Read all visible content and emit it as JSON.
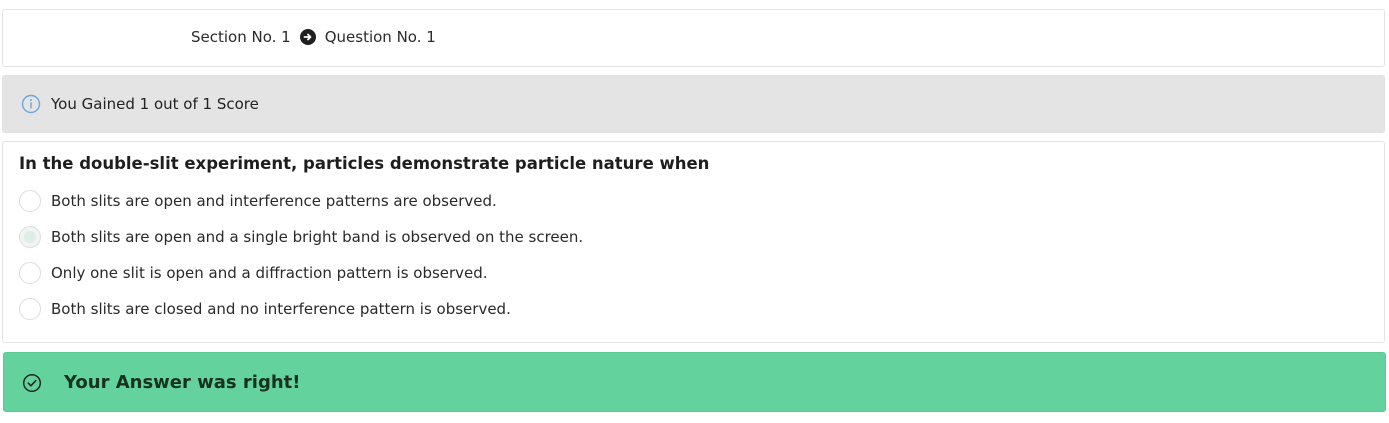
{
  "breadcrumb": {
    "section": "Section No. 1",
    "question": "Question No. 1",
    "separator_icon": "arrow-right-circle-icon"
  },
  "score": {
    "icon": "info-icon",
    "text": "You Gained 1 out of 1 Score"
  },
  "question": {
    "title": "In the double-slit experiment, particles demonstrate particle nature when",
    "options": [
      {
        "label": "Both slits are open and interference patterns are observed.",
        "selected": false
      },
      {
        "label": "Both slits are open and a single bright band is observed on the screen.",
        "selected": true
      },
      {
        "label": "Only one slit is open and a diffraction pattern is observed.",
        "selected": false
      },
      {
        "label": "Both slits are closed and no interference pattern is observed.",
        "selected": false
      }
    ]
  },
  "result": {
    "icon": "check-circle-icon",
    "text": "Your Answer was right!",
    "color": "#63d29c"
  },
  "colors": {
    "score_background": "#e4e4e4",
    "info_icon": "#6aa8e0",
    "result_background": "#63d29c"
  }
}
